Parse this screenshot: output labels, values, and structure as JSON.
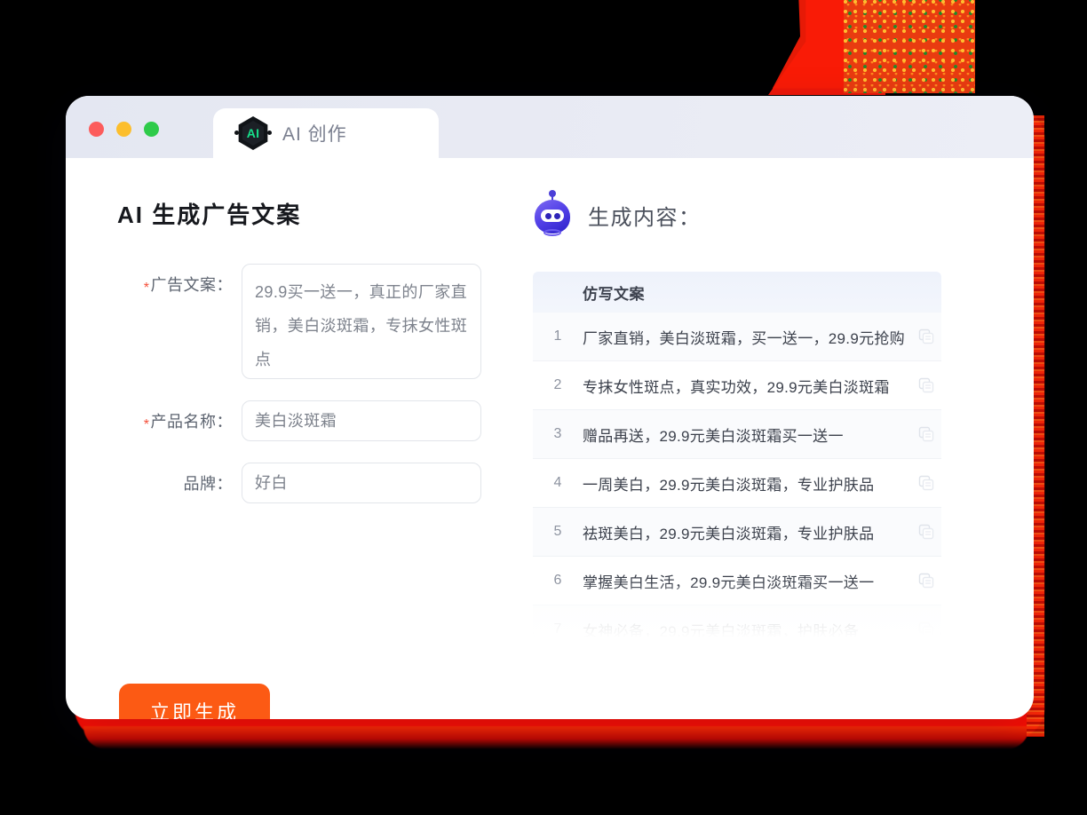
{
  "window": {
    "traffic_lights": [
      {
        "name": "close",
        "color": "#fc5c5c"
      },
      {
        "name": "minimize",
        "color": "#fcbe2d"
      },
      {
        "name": "maximize",
        "color": "#2ecb4a"
      }
    ],
    "tab": {
      "icon": "ai-hexagon-badge",
      "icon_text": "AI",
      "label": "AI 创作"
    }
  },
  "left": {
    "title": "AI 生成广告文案",
    "fields": [
      {
        "label": "广告文案：",
        "required": true,
        "type": "textarea",
        "value": "29.9买一送一，真正的厂家直销，美白淡斑霜，专抹女性斑点"
      },
      {
        "label": "产品名称：",
        "required": true,
        "type": "input",
        "value": "美白淡斑霜"
      },
      {
        "label": "品牌：",
        "required": false,
        "type": "input",
        "value": "好白"
      }
    ],
    "generate_button": "立即生成"
  },
  "right": {
    "icon": "robot-head-icon",
    "title": "生成内容：",
    "table": {
      "column_header": "仿写文案",
      "copy_icon": "copy-icon",
      "rows": [
        {
          "index": "1",
          "text": "厂家直销，美白淡斑霜，买一送一，29.9元抢购"
        },
        {
          "index": "2",
          "text": "专抹女性斑点，真实功效，29.9元美白淡斑霜"
        },
        {
          "index": "3",
          "text": "赠品再送，29.9元美白淡斑霜买一送一"
        },
        {
          "index": "4",
          "text": "一周美白，29.9元美白淡斑霜，专业护肤品"
        },
        {
          "index": "5",
          "text": "祛斑美白，29.9元美白淡斑霜，专业护肤品"
        },
        {
          "index": "6",
          "text": "掌握美白生活，29.9元美白淡斑霜买一送一"
        },
        {
          "index": "7",
          "text": "女神必备，29.9元美白淡斑霜，护肤必备"
        }
      ]
    }
  },
  "colors": {
    "accent_orange": "#fc5a14",
    "required_star": "#f4503a",
    "ai_green": "#17e08a",
    "robot_purple": "#4b3fd8",
    "titlebar_bg": "#e8eaf3",
    "deco_red": "#fb0d00"
  }
}
